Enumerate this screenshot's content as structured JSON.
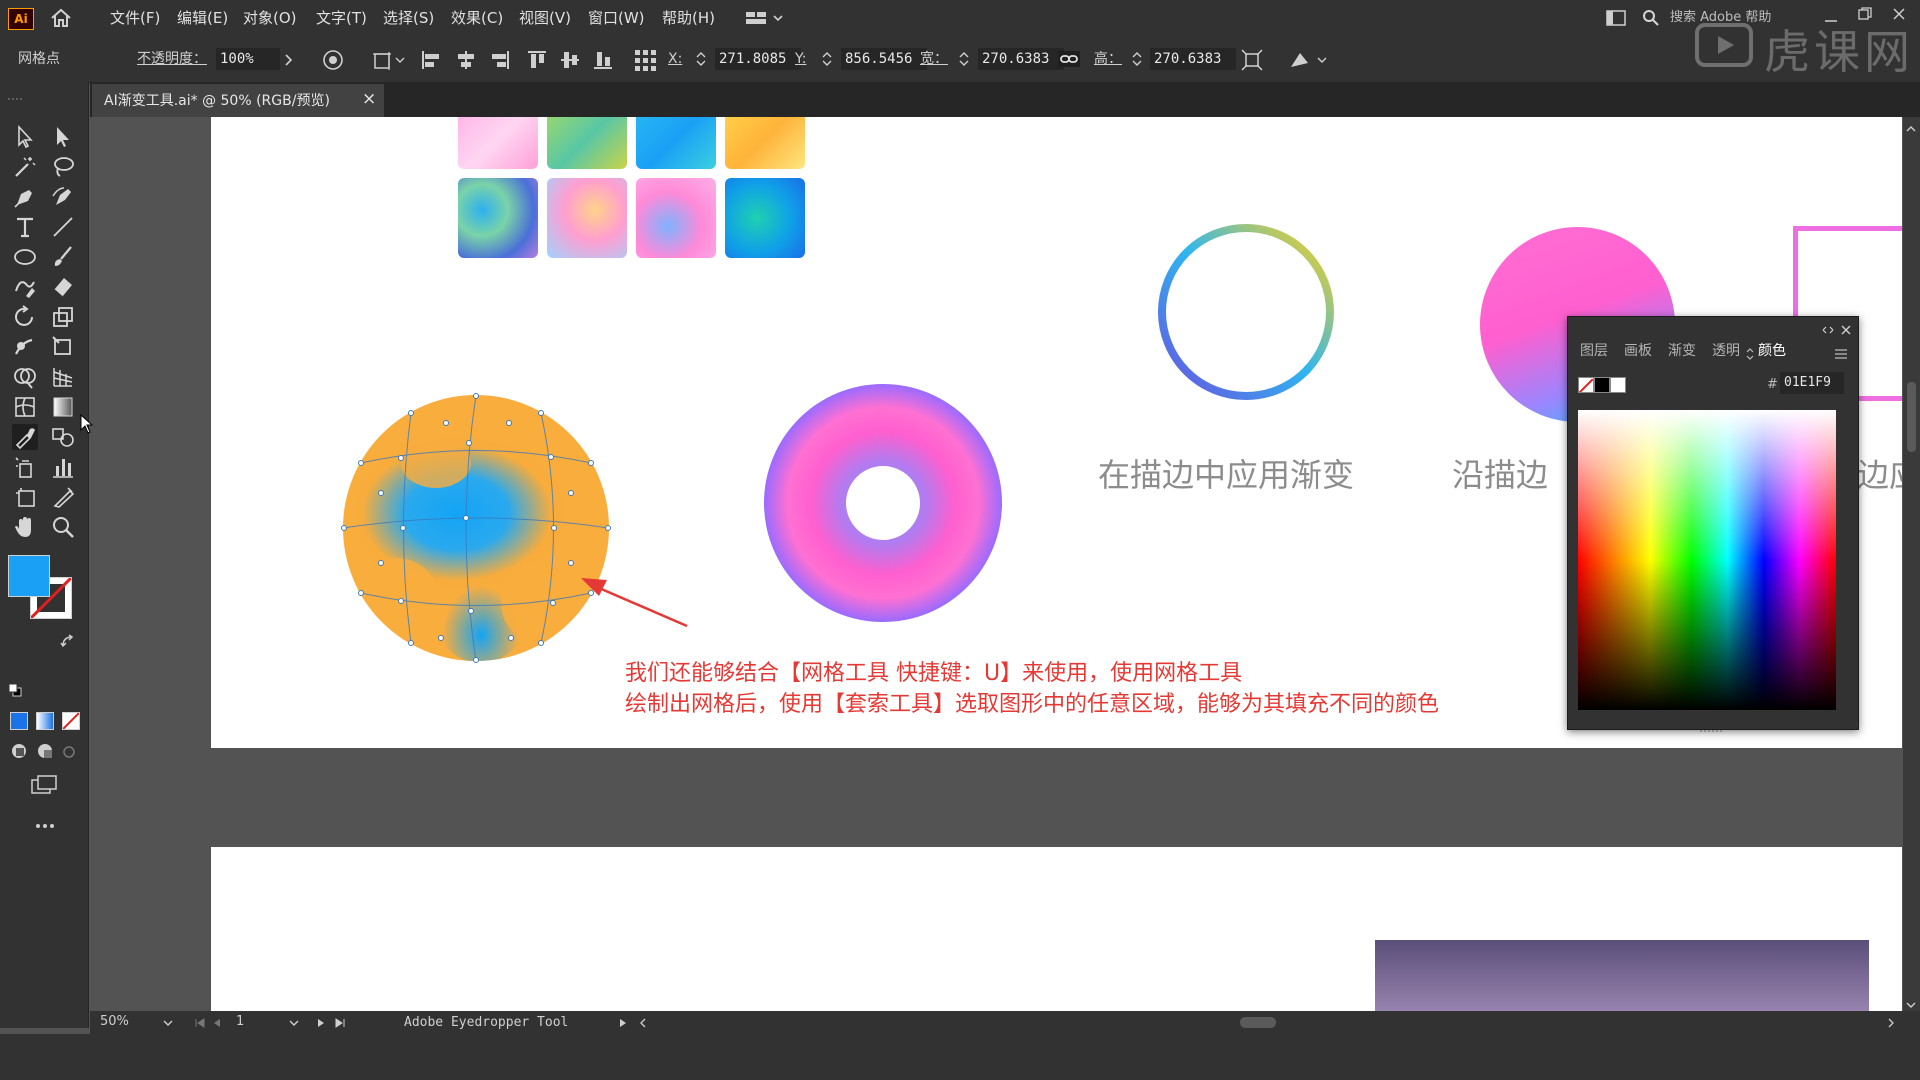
{
  "app": {
    "logo": "Ai"
  },
  "menu": {
    "items": [
      "文件(F)",
      "编辑(E)",
      "对象(O)",
      "文字(T)",
      "选择(S)",
      "效果(C)",
      "视图(V)",
      "窗口(W)",
      "帮助(H)"
    ],
    "search_placeholder": "搜索 Adobe 帮助"
  },
  "control_bar": {
    "mode_label": "网格点",
    "opacity_label": "不透明度：",
    "opacity_value": "100%",
    "x_label": "X:",
    "x_value": "271.8085",
    "y_label": "Y:",
    "y_value": "856.5456",
    "w_label": "宽：",
    "w_value": "270.6383",
    "h_label": "高：",
    "h_value": "270.6383"
  },
  "document_tab": {
    "title": "AI渐变工具.ai* @ 50% (RGB/预览)",
    "close_glyph": "×"
  },
  "canvas": {
    "caption_line1": "我们还能够结合【网格工具 快捷键：U】来使用，使用网格工具",
    "caption_line2": "绘制出网格后，使用【套索工具】选取图形中的任意区域，能够为其填充不同的颜色",
    "label_stroke_gradient": "在描边中应用渐变",
    "label_along_stroke": "沿描边",
    "label_cut_right": "边应"
  },
  "color_panel": {
    "tabs": [
      "图层",
      "画板",
      "渐变",
      "透明",
      "颜色"
    ],
    "active_tab": "颜色",
    "hex_label": "#",
    "hex_value": "01E1F9"
  },
  "status_bar": {
    "zoom": "50%",
    "artboard_number": "1",
    "tool_name": "Adobe Eyedropper Tool"
  },
  "watermark": {
    "text": "虎课网"
  },
  "colors": {
    "fill": "#1aa0f5",
    "caption": "#e53935",
    "ui_dark": "#323232",
    "pasteboard": "#535353"
  }
}
